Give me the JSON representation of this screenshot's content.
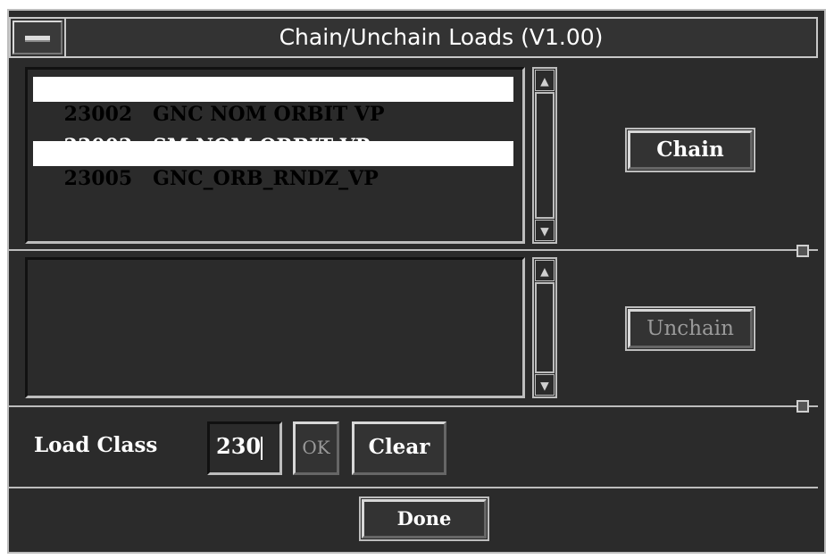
{
  "window": {
    "title": "Chain/Unchain Loads (V1.00)"
  },
  "loads_list": {
    "items": [
      {
        "code": "23002",
        "name": "GNC NOM ORBIT VP",
        "selected": true
      },
      {
        "code": "23003",
        "name": "SM NOM ORBIT VP",
        "selected": false
      },
      {
        "code": "23005",
        "name": "GNC_ORB_RNDZ_VP",
        "selected": true
      }
    ]
  },
  "chained_list": {
    "items": []
  },
  "buttons": {
    "chain": "Chain",
    "unchain": "Unchain",
    "ok": "OK",
    "clear": "Clear",
    "done": "Done"
  },
  "load_class": {
    "label": "Load Class",
    "value": "230"
  },
  "icons": {
    "scroll_up": "up-arrow-icon",
    "scroll_down": "down-arrow-icon",
    "window_menu": "window-menu-icon"
  },
  "colors": {
    "background": "#2b2b2b",
    "selection": "#ffffff",
    "bevel": "#bdbdbd"
  }
}
